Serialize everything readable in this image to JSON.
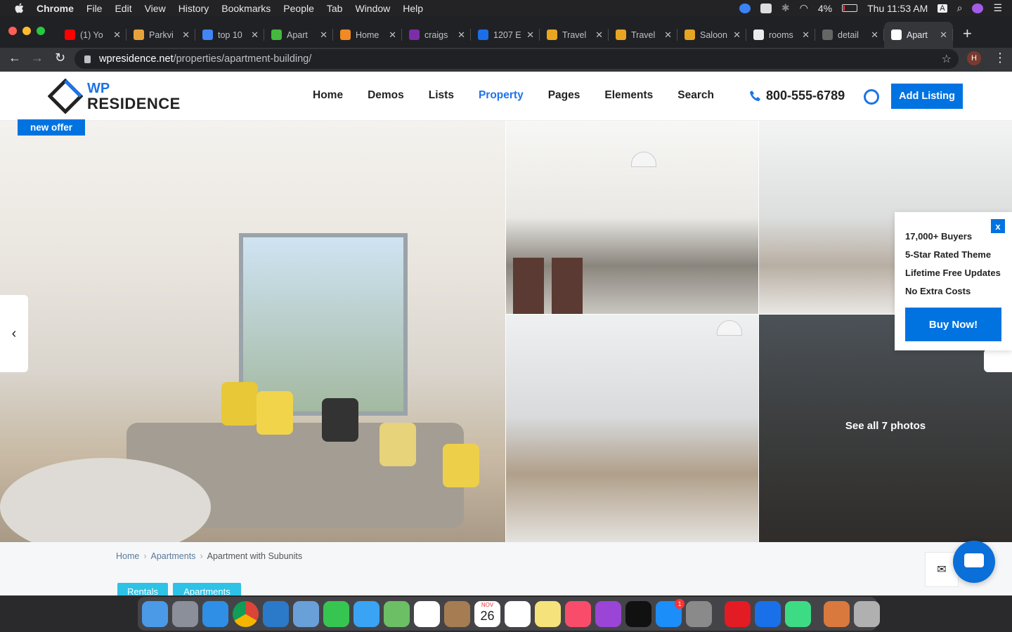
{
  "menubar": {
    "app": "Chrome",
    "items": [
      "File",
      "Edit",
      "View",
      "History",
      "Bookmarks",
      "People",
      "Tab",
      "Window",
      "Help"
    ],
    "battery": "4%",
    "clock": "Thu 11:53 AM",
    "input_source": "A"
  },
  "tabs": [
    {
      "label": "(1) Yo",
      "color": "#ff0000"
    },
    {
      "label": "Parkvi",
      "color": "#e9a23b"
    },
    {
      "label": "top 10",
      "color": "#4285f4"
    },
    {
      "label": "Apart",
      "color": "#44b93d"
    },
    {
      "label": "Home",
      "color": "#f08a24"
    },
    {
      "label": "craigs",
      "color": "#7b2ea8"
    },
    {
      "label": "1207 E",
      "color": "#1a6fe8"
    },
    {
      "label": "Travel",
      "color": "#e7a521"
    },
    {
      "label": "Travel",
      "color": "#e7a521"
    },
    {
      "label": "Saloon",
      "color": "#e7a521"
    },
    {
      "label": "rooms",
      "color": "#ececec"
    },
    {
      "label": "detail",
      "color": "#666666"
    },
    {
      "label": "Apart",
      "color": "#ffffff"
    }
  ],
  "address": {
    "host": "wpresidence.net",
    "path": "/properties/apartment-building/"
  },
  "profile_initial": "H",
  "site": {
    "logo_top": "WP",
    "logo_bottom": "RESIDENCE",
    "nav": [
      "Home",
      "Demos",
      "Lists",
      "Property",
      "Pages",
      "Elements",
      "Search"
    ],
    "active_nav": "Property",
    "phone": "800-555-6789",
    "add_listing": "Add Listing",
    "brand_color": "#0073e1"
  },
  "gallery": {
    "badge": "new offer",
    "see_all": "See all 7 photos"
  },
  "promo": {
    "close": "x",
    "features": [
      "17,000+ Buyers",
      "5-Star Rated Theme",
      "Lifetime Free Updates",
      "No Extra Costs"
    ],
    "button": "Buy Now!"
  },
  "breadcrumb": [
    "Home",
    "Apartments",
    "Apartment with Subunits"
  ],
  "categories": [
    "Rentals",
    "Apartments"
  ],
  "dock": {
    "apps": [
      "finder",
      "launchpad",
      "safari",
      "chrome",
      "vscode",
      "preview",
      "facetime",
      "messages",
      "maps",
      "photos",
      "contacts",
      "calendar",
      "reminders",
      "notes",
      "music",
      "podcasts",
      "tv",
      "app-store",
      "system-preferences",
      "anydesk",
      "teamviewer",
      "android-studio",
      "archive",
      "trash"
    ],
    "calendar_month": "NOV",
    "calendar_day": "26",
    "app_store_badge": "1"
  }
}
